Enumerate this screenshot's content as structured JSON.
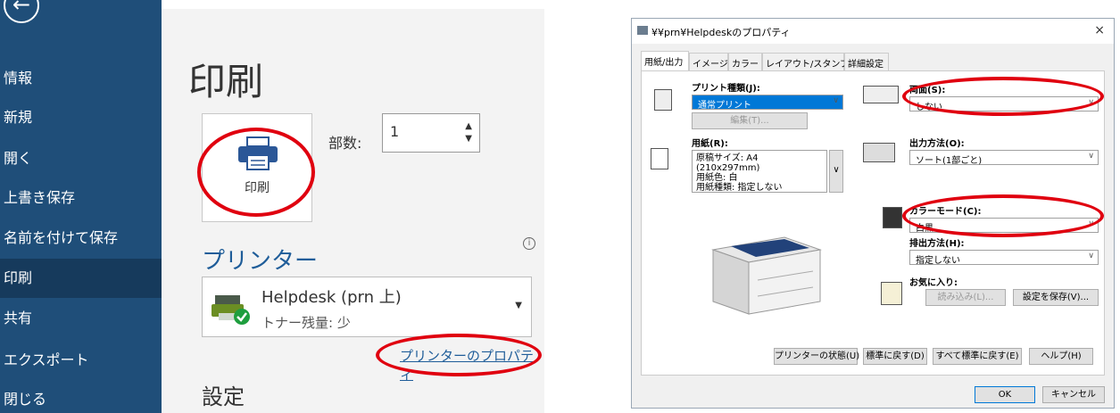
{
  "word": {
    "back_glyph": "←",
    "sidebar": [
      {
        "label": "情報"
      },
      {
        "label": "新規"
      },
      {
        "label": "開く"
      },
      {
        "label": "上書き保存"
      },
      {
        "label": "名前を付けて保存"
      },
      {
        "label": "印刷",
        "active": true
      },
      {
        "label": "共有"
      },
      {
        "label": "エクスポート"
      },
      {
        "label": "閉じる"
      }
    ],
    "title": "印刷",
    "print_button_label": "印刷",
    "copies_label": "部数:",
    "copies_value": "1",
    "printer_heading": "プリンター",
    "info_glyph": "i",
    "printer_name": "Helpdesk (prn 上)",
    "printer_status": "トナー残量: 少",
    "printer_properties_link": "プリンターのプロパティ",
    "settings_heading": "設定"
  },
  "dialog": {
    "title": "¥¥prn¥Helpdeskのプロパティ",
    "close_glyph": "×",
    "tabs": [
      "用紙/出力",
      "イメージ",
      "カラー",
      "レイアウト/スタンプ",
      "詳細設定"
    ],
    "print_type_label": "プリント種類(J):",
    "print_type_value": "通常プリント",
    "edit_button": "編集(T)...",
    "paper_label": "用紙(R):",
    "paper_lines": [
      "原稿サイズ: A4 (210x297mm)",
      "用紙色: 白",
      "用紙種類: 指定しない"
    ],
    "duplex_label": "両面(S):",
    "duplex_value": "しない",
    "output_label": "出力方法(O):",
    "output_value": "ソート(1部ごと)",
    "color_mode_label": "カラーモード(C):",
    "color_mode_value": "白黒",
    "eject_label": "排出方法(H):",
    "eject_value": "指定しない",
    "favorites_label": "お気に入り:",
    "load_button": "読み込み(L)...",
    "save_settings_button": "設定を保存(V)...",
    "printer_status_button": "プリンターの状態(U)",
    "restore_default_button": "標準に戻す(D)",
    "restore_all_button": "すべて標準に戻す(E)",
    "help_button": "ヘルプ(H)",
    "ok_button": "OK",
    "cancel_button": "キャンセル"
  },
  "colors": {
    "sidebar": "#1f4e79",
    "accent_blue": "#1f5d99",
    "annotation_red": "#e0000f"
  }
}
